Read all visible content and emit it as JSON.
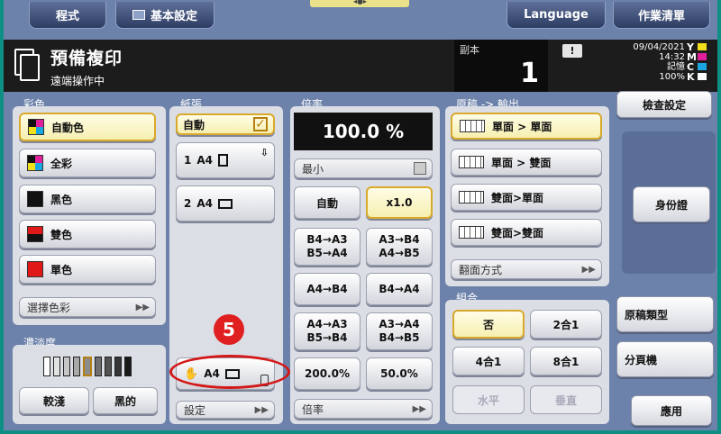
{
  "topbar": {
    "program": "程式",
    "basic": "基本設定",
    "language": "Language",
    "jobs": "作業清單"
  },
  "header": {
    "title": "預備複印",
    "subtitle": "遠端操作中",
    "copies_label": "副本",
    "copies": "1",
    "warning": "!",
    "date": "09/04/2021",
    "time": "14:32",
    "memory_label": "記憶",
    "memory": "100%",
    "toner": [
      "Y",
      "M",
      "C",
      "K"
    ],
    "toner_colors": [
      "#f2e01a",
      "#e0209a",
      "#1aa6e0",
      "#111111"
    ]
  },
  "color": {
    "label": "彩色",
    "items": [
      {
        "label": "自動色",
        "selected": true
      },
      {
        "label": "全彩"
      },
      {
        "label": "黑色"
      },
      {
        "label": "雙色"
      },
      {
        "label": "單色"
      }
    ],
    "select": "選擇色彩"
  },
  "density": {
    "label": "濃淡度",
    "lighter": "較淺",
    "darker": "黑的",
    "level": 5,
    "steps": 9
  },
  "paper": {
    "label": "紙張",
    "auto": "自動",
    "tray1_num": "1",
    "tray1": "A4",
    "tray2_num": "2",
    "tray2": "A4",
    "bypass": "A4",
    "settings": "設定"
  },
  "ratio": {
    "label": "倍率",
    "value": "100.0 %",
    "min": "最小",
    "auto": "自動",
    "x10": "x1.0",
    "p1": [
      "B4→A3",
      "B5→A4"
    ],
    "p2": [
      "A3→B4",
      "A4→B5"
    ],
    "p3": "A4→B4",
    "p4": "B4→A4",
    "p5": [
      "A4→A3",
      "B5→B4"
    ],
    "p6": [
      "A3→A4",
      "B4→B5"
    ],
    "p7": "200.0%",
    "p8": "50.0%",
    "bottom": "倍率"
  },
  "original": {
    "label": "原稿 -> 輸出",
    "items": [
      "單面 > 單面",
      "單面 > 雙面",
      "雙面>單面",
      "雙面>雙面"
    ],
    "flip": "翻面方式"
  },
  "combine": {
    "label": "組合",
    "no": "否",
    "two": "2合1",
    "four": "4合1",
    "eight": "8合1",
    "horizontal": "水平",
    "vertical": "垂直"
  },
  "right": {
    "check": "檢查設定",
    "id": "身份證",
    "type": "原稿類型",
    "sort": "分頁機",
    "apply": "應用"
  },
  "annotation": {
    "number": "5"
  }
}
